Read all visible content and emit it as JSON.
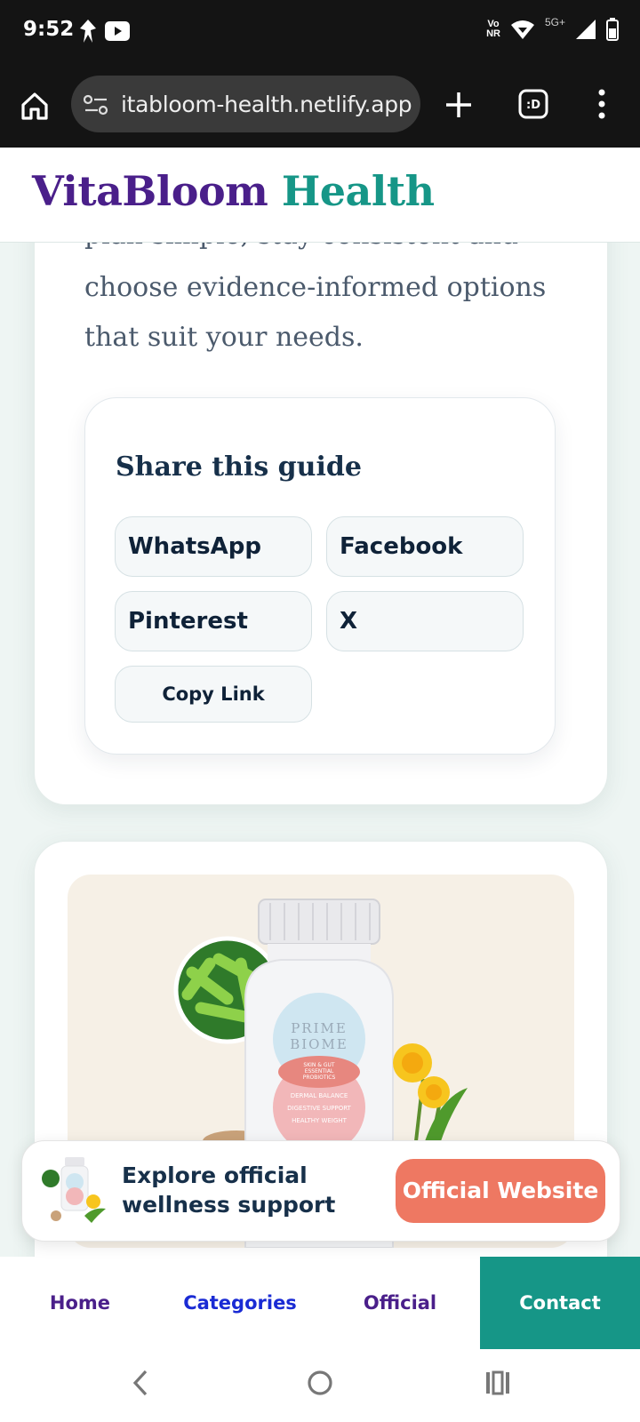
{
  "status": {
    "time": "9:52",
    "network_top": "Vo",
    "network_bottom": "NR",
    "signal_label": "5G+"
  },
  "browser": {
    "url": "itabloom-health.netlify.app"
  },
  "site": {
    "brand_part1": "VitaBloom",
    "brand_part2": "Health"
  },
  "article": {
    "intro_lines": [
      "plan simple, stay consistent and",
      "choose evidence-informed options",
      "that suit your needs."
    ]
  },
  "share": {
    "title": "Share this guide",
    "whatsapp": "WhatsApp",
    "facebook": "Facebook",
    "pinterest": "Pinterest",
    "x": "X",
    "copy": "Copy Link"
  },
  "product": {
    "brand_line1": "PRIME",
    "brand_line2": "BIOME",
    "tag_lines": [
      "SKIN & GUT",
      "ESSENTIAL",
      "PROBIOTICS"
    ],
    "benefits": [
      "DERMAL BALANCE",
      "DIGESTIVE SUPPORT",
      "HEALTHY WEIGHT"
    ]
  },
  "sticky": {
    "text": "Explore official wellness support",
    "button": "Official Website"
  },
  "nav": {
    "home": "Home",
    "categories": "Categories",
    "official": "Official",
    "contact": "Contact"
  },
  "colors": {
    "brand_purple": "#4a1f8a",
    "brand_teal": "#169687",
    "cta_coral": "#ee7862",
    "nav_active": "#169687"
  }
}
